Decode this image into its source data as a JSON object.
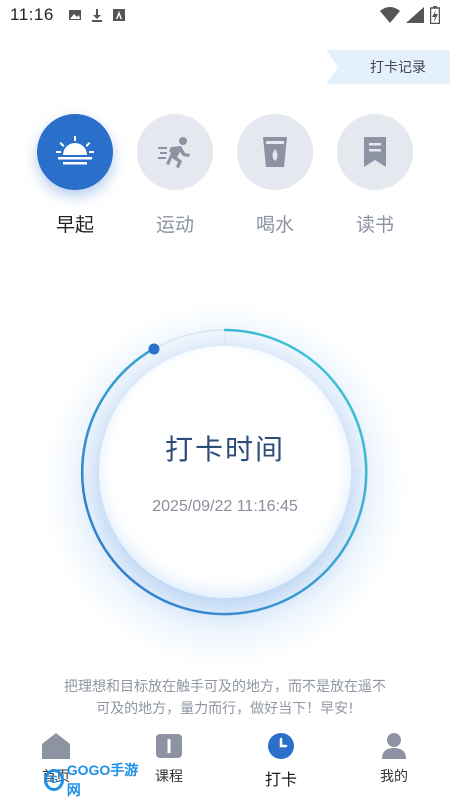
{
  "status_bar": {
    "time": "11:16",
    "left_icons": [
      "image-icon",
      "download-icon",
      "font-icon"
    ],
    "right_icons": [
      "wifi-icon",
      "signal-icon",
      "battery-icon"
    ]
  },
  "header": {
    "records_label": "打卡记录"
  },
  "categories": [
    {
      "label": "早起",
      "icon": "sunrise-icon",
      "active": true
    },
    {
      "label": "运动",
      "icon": "running-icon",
      "active": false
    },
    {
      "label": "喝水",
      "icon": "water-cup-icon",
      "active": false
    },
    {
      "label": "读书",
      "icon": "bookmark-icon",
      "active": false
    }
  ],
  "dial": {
    "title": "打卡时间",
    "datetime": "2025/09/22 11:16:45"
  },
  "motto": {
    "line1": "把理想和目标放在触手可及的地方，而不是放在遥不",
    "line2": "可及的地方，量力而行，做好当下！早安!"
  },
  "bottom_nav": [
    {
      "label": "首页",
      "icon": "home-icon",
      "active": false
    },
    {
      "label": "课程",
      "icon": "course-icon",
      "active": false
    },
    {
      "label": "打卡",
      "icon": "clock-icon",
      "active": true
    },
    {
      "label": "我的",
      "icon": "user-icon",
      "active": false
    }
  ],
  "watermark": {
    "text": "GOGO手游网"
  },
  "colors": {
    "accent": "#2a6fc9",
    "inactive_circle": "#e6e8ef",
    "inactive_icon": "#8e93a3",
    "ring_start": "#3fd0d8",
    "ring_end": "#2a6fc9"
  }
}
